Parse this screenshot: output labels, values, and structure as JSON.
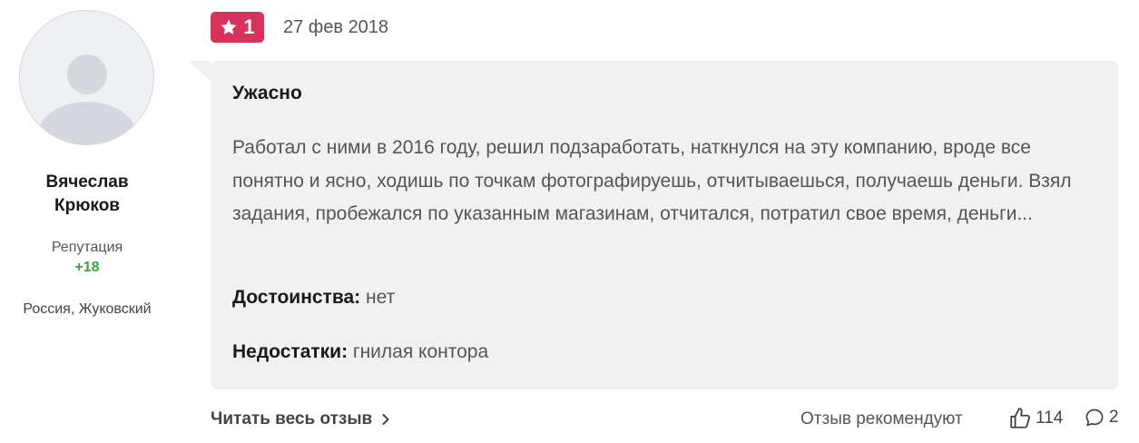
{
  "author": {
    "first_name": "Вячеслав",
    "last_name": "Крюков",
    "reputation_label": "Репутация",
    "reputation_value": "+18",
    "location": "Россия, Жуковский",
    "avatar_icon": "user-placeholder-icon"
  },
  "review": {
    "rating": "1",
    "rating_icon": "star-icon",
    "rating_color": "#d8315b",
    "date": "27 фев 2018",
    "title": "Ужасно",
    "text": "Работал с ними в 2016 году, решил подзаработать, наткнулся на эту компанию, вроде все понятно и ясно, ходишь по точкам фотографируешь, отчитываешься, получаешь деньги. Взял задания, пробежался по указанным магазинам, отчитался, потратил свое время, деньги...",
    "pros_label": "Достоинства:",
    "pros_value": "нет",
    "cons_label": "Недостатки:",
    "cons_value": "гнилая контора"
  },
  "footer": {
    "read_more_label": "Читать весь отзыв",
    "recommend_label": "Отзыв рекомендуют",
    "likes_count": "114",
    "comments_count": "2",
    "reputation_color": "#3aa53a"
  }
}
